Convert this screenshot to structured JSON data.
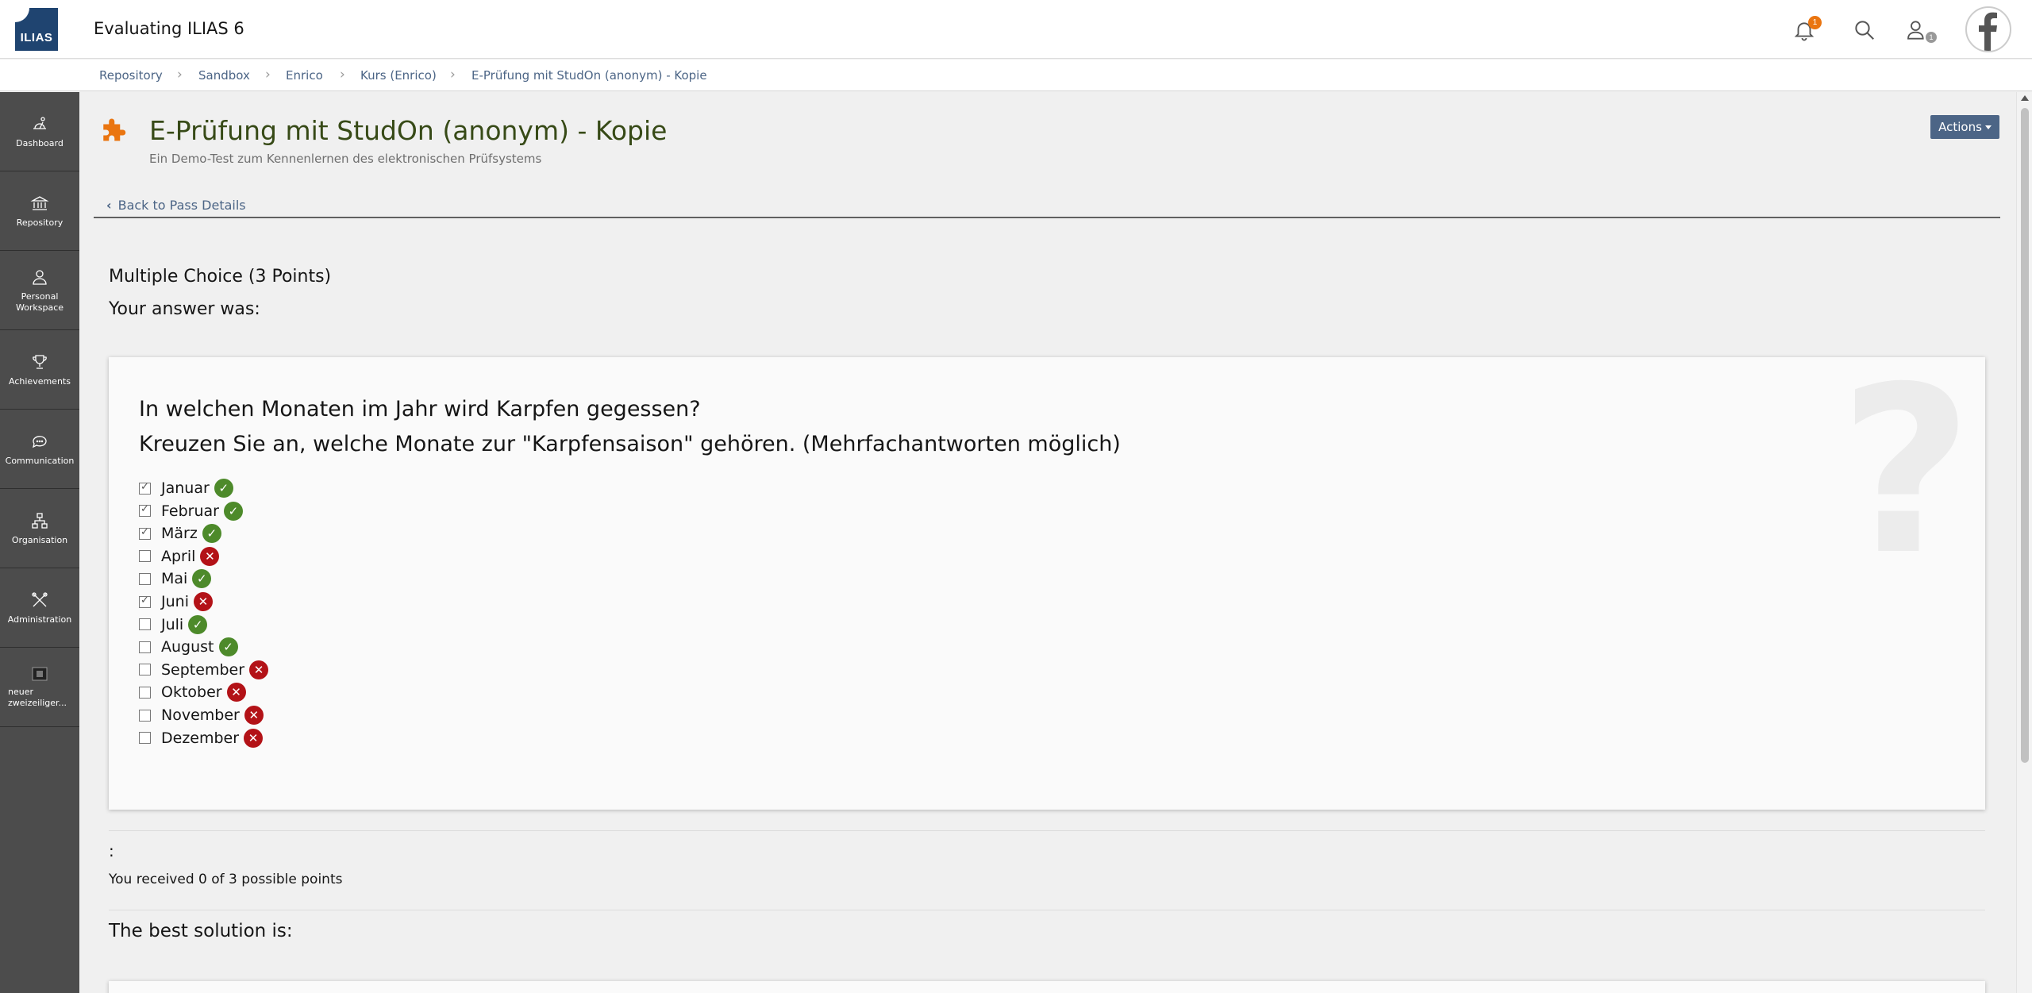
{
  "header": {
    "logo_text": "ILIAS",
    "app_title": "Evaluating ILIAS 6",
    "notification_count": "1",
    "user_badge": "1"
  },
  "breadcrumb": [
    {
      "label": "Repository"
    },
    {
      "label": "Sandbox"
    },
    {
      "label": "Enrico"
    },
    {
      "label": "Kurs (Enrico)"
    },
    {
      "label": "E-Prüfung mit StudOn (anonym) - Kopie"
    }
  ],
  "sidebar": {
    "items": [
      {
        "label": "Dashboard",
        "icon": "dashboard-icon"
      },
      {
        "label": "Repository",
        "icon": "repository-icon"
      },
      {
        "label": "Personal Workspace",
        "icon": "person-icon"
      },
      {
        "label": "Achievements",
        "icon": "trophy-icon"
      },
      {
        "label": "Communication",
        "icon": "chat-icon"
      },
      {
        "label": "Organisation",
        "icon": "org-icon"
      },
      {
        "label": "Administration",
        "icon": "tools-icon"
      },
      {
        "label": "neuer zweizeiliger...",
        "icon": "image-icon"
      }
    ]
  },
  "page": {
    "title": "E-Prüfung mit StudOn (anonym) - Kopie",
    "description": "Ein Demo-Test zum Kennenlernen des elektronischen Prüfsystems",
    "actions_label": "Actions",
    "back_link": "Back to Pass Details"
  },
  "question": {
    "type_label": "Multiple Choice (3 Points)",
    "your_answer_label": "Your answer was:",
    "line1": "In welchen Monaten im Jahr wird Karpfen gegessen?",
    "line2": "Kreuzen Sie an, welche Monate zur \"Karpfensaison\" gehören. (Mehrfachantworten möglich)",
    "options": [
      {
        "label": "Januar",
        "checked": true,
        "correct": true
      },
      {
        "label": "Februar",
        "checked": true,
        "correct": true
      },
      {
        "label": "März",
        "checked": true,
        "correct": true
      },
      {
        "label": "April",
        "checked": false,
        "correct": false
      },
      {
        "label": "Mai",
        "checked": false,
        "correct": true
      },
      {
        "label": "Juni",
        "checked": true,
        "correct": false
      },
      {
        "label": "Juli",
        "checked": false,
        "correct": true
      },
      {
        "label": "August",
        "checked": false,
        "correct": true
      },
      {
        "label": "September",
        "checked": false,
        "correct": false
      },
      {
        "label": "Oktober",
        "checked": false,
        "correct": false
      },
      {
        "label": "November",
        "checked": false,
        "correct": false
      },
      {
        "label": "Dezember",
        "checked": false,
        "correct": false
      }
    ]
  },
  "result": {
    "colon": ":",
    "points_text": "You received 0 of 3 possible points",
    "best_solution_label": "The best solution is:"
  },
  "colors": {
    "accent": "#4c6586",
    "sidebar": "#4c4c4c",
    "correct": "#4d8a2a",
    "wrong": "#b31217",
    "notification": "#ea7510"
  }
}
